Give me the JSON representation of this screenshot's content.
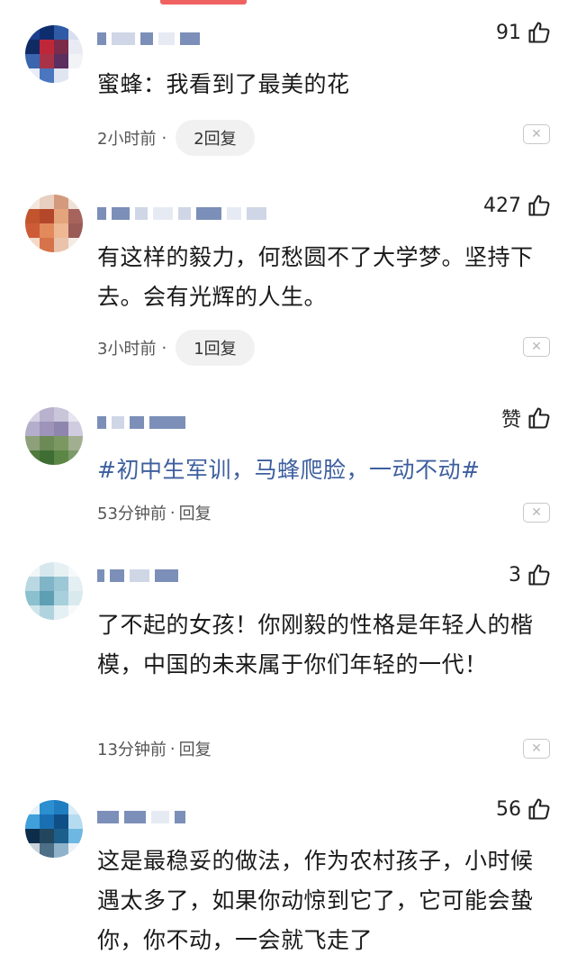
{
  "comments": [
    {
      "likes": "91",
      "text": "蜜蜂：我看到了最美的花",
      "time": "2小时前",
      "separator": "·",
      "reply_label": "2回复",
      "colors": [
        "#1b3f8c",
        "#0e2d6e",
        "#2f5aa6",
        "#d9dfee",
        "#102a64",
        "#c0263a",
        "#7a2c4a",
        "#e8ebf3",
        "#3a66b0",
        "#a83348",
        "#5b2f5e",
        "#f2f3f7",
        "#e9edf6",
        "#4a76bf",
        "#dfe5f1",
        "#ffffff"
      ]
    },
    {
      "likes": "427",
      "text": "有这样的毅力，何愁圆不了大学梦。坚持下去。会有光辉的人生。",
      "time": "3小时前",
      "separator": "·",
      "reply_label": "1回复",
      "colors": [
        "#f3e7de",
        "#e8cfc0",
        "#d39a7e",
        "#f0e1d6",
        "#c2542e",
        "#b4472a",
        "#e4a47c",
        "#a7645c",
        "#cd5c36",
        "#e28a5c",
        "#efb894",
        "#9a5a56",
        "#f4d9c6",
        "#d6734a",
        "#e9c3aa",
        "#f5ebe4"
      ]
    },
    {
      "likes": "赞",
      "text": "#初中生军训，马蜂爬脸，一动不动#",
      "time": "53分钟前",
      "separator": "·",
      "reply_label": "回复",
      "colors": [
        "#d7d3e4",
        "#b8b2cf",
        "#c9c6da",
        "#e7e5ef",
        "#b3aecb",
        "#9e93b8",
        "#8f86ad",
        "#cfcbe0",
        "#8ea07a",
        "#6c8a55",
        "#7c9862",
        "#a1ae90",
        "#4f7a3c",
        "#3f6e34",
        "#5c8646",
        "#7d9a6a"
      ]
    },
    {
      "likes": "3",
      "text": "了不起的女孩！你刚毅的性格是年轻人的楷模，中国的未来属于你们年轻的一代！",
      "time": "13分钟前",
      "separator": "·",
      "reply_label": "回复",
      "colors": [
        "#f0f6f8",
        "#d6e8ee",
        "#e7f1f4",
        "#f5fafb",
        "#b9d8e2",
        "#7fb5c6",
        "#9cc7d4",
        "#e3eff3",
        "#8bc0cf",
        "#5e9fb4",
        "#a8d0dc",
        "#d9eaef",
        "#cfe5ec",
        "#b0d4df",
        "#e4f0f4",
        "#f6fafb"
      ]
    },
    {
      "likes": "56",
      "text": "这是最稳妥的做法，作为农村孩子，小时候遇太多了，如果你动惊到它了，它可能会蛰你，你不动，一会就飞走了",
      "time": "",
      "separator": "",
      "reply_label": "",
      "colors": [
        "#e6f1f8",
        "#2b8fd0",
        "#1f7dc0",
        "#d9ecf7",
        "#3fa0dc",
        "#1a6fb2",
        "#0f4f86",
        "#b5dbf1",
        "#0d2d4a",
        "#23465f",
        "#1c5f8d",
        "#6fb7e3",
        "#c9d3dc",
        "#4d6f87",
        "#8fb3ca",
        "#eaf2f7"
      ]
    }
  ]
}
